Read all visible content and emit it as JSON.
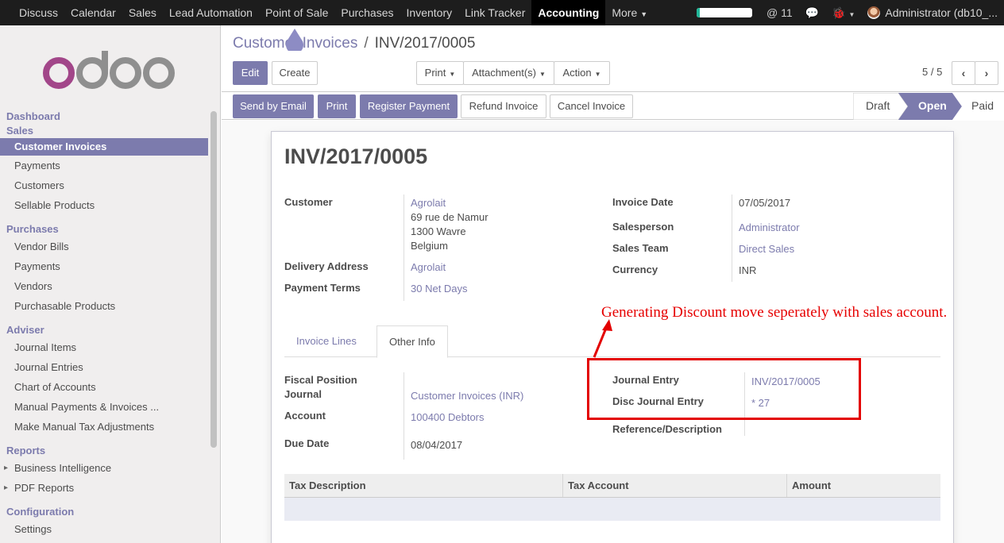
{
  "topbar": {
    "menu": [
      "Discuss",
      "Calendar",
      "Sales",
      "Lead Automation",
      "Point of Sale",
      "Purchases",
      "Inventory",
      "Link Tracker",
      "Accounting",
      "More"
    ],
    "active": "Accounting",
    "progress": 0.05,
    "notifications": "@ 11",
    "user": "Administrator (db10_..."
  },
  "sidebar": {
    "sections": [
      {
        "title": "Dashboard",
        "items": []
      },
      {
        "title": "Sales",
        "items": [
          "Customer Invoices",
          "Payments",
          "Customers",
          "Sellable Products"
        ]
      },
      {
        "title": "Purchases",
        "items": [
          "Vendor Bills",
          "Payments",
          "Vendors",
          "Purchasable Products"
        ]
      },
      {
        "title": "Adviser",
        "items": [
          "Journal Items",
          "Journal Entries",
          "Chart of Accounts",
          "Manual Payments & Invoices ...",
          "Make Manual Tax Adjustments"
        ]
      },
      {
        "title": "Reports",
        "items": [
          "Business Intelligence",
          "PDF Reports"
        ]
      },
      {
        "title": "Configuration",
        "items": [
          "Settings"
        ]
      }
    ]
  },
  "breadcrumb": {
    "parent": "Customer Invoices",
    "current": "INV/2017/0005"
  },
  "buttons": {
    "edit": "Edit",
    "create": "Create",
    "print": "Print",
    "attachments": "Attachment(s)",
    "action": "Action",
    "send_email": "Send by Email",
    "print2": "Print",
    "register_payment": "Register Payment",
    "refund": "Refund Invoice",
    "cancel": "Cancel Invoice"
  },
  "pager": {
    "text": "5 / 5"
  },
  "stages": [
    "Draft",
    "Open",
    "Paid"
  ],
  "current_stage": "Open",
  "invoice": {
    "number": "INV/2017/0005",
    "customer_label": "Customer",
    "customer": "Agrolait",
    "address1": "69 rue de Namur",
    "address2": "1300 Wavre",
    "address3": "Belgium",
    "delivery_label": "Delivery Address",
    "delivery": "Agrolait",
    "terms_label": "Payment Terms",
    "terms": "30 Net Days",
    "date_label": "Invoice Date",
    "date": "07/05/2017",
    "salesperson_label": "Salesperson",
    "salesperson": "Administrator",
    "team_label": "Sales Team",
    "team": "Direct Sales",
    "currency_label": "Currency",
    "currency": "INR"
  },
  "tabs": [
    "Invoice Lines",
    "Other Info"
  ],
  "other_info": {
    "fiscal_label": "Fiscal Position",
    "journal_label": "Journal",
    "journal": "Customer Invoices (INR)",
    "account_label": "Account",
    "account": "100400 Debtors",
    "due_label": "Due Date",
    "due": "08/04/2017",
    "je_label": "Journal Entry",
    "je": "INV/2017/0005",
    "disc_label": "Disc Journal Entry",
    "disc": "* 27",
    "ref_label": "Reference/Description"
  },
  "tax_table": {
    "headers": [
      "Tax Description",
      "Tax Account",
      "Amount"
    ]
  },
  "annotation": "Generating Discount move seperately with sales account."
}
